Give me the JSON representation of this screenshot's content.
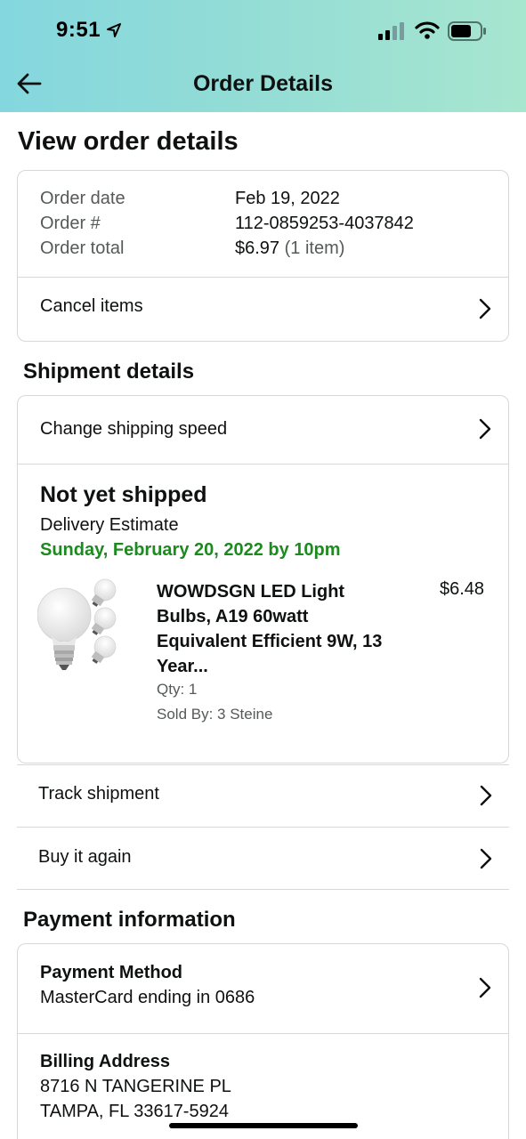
{
  "status_bar": {
    "time": "9:51",
    "icons": [
      "location-arrow-icon",
      "signal-bars-icon",
      "wifi-icon",
      "battery-icon"
    ]
  },
  "header": {
    "title": "Order Details",
    "back_icon": "arrow-left-icon",
    "gradient_colors": [
      "#84d7df",
      "#a7e6cf"
    ]
  },
  "page_title": "View order details",
  "order_summary": {
    "order_date_label": "Order date",
    "order_date": "Feb 19, 2022",
    "order_number_label": "Order #",
    "order_number": "112-0859253-4037842",
    "order_total_label": "Order total",
    "order_total": "$6.97",
    "item_count": "(1 item)",
    "cancel_items_label": "Cancel items"
  },
  "shipment": {
    "section_title": "Shipment details",
    "change_speed_label": "Change shipping speed",
    "status": "Not yet shipped",
    "delivery_estimate_label": "Delivery Estimate",
    "delivery_date": "Sunday, February 20, 2022 by 10pm",
    "delivery_date_color": "#1c8a1f",
    "item": {
      "title": "WOWDSGN LED Light Bulbs, A19 60watt Equivalent Efficient 9W, 13 Year...",
      "price": "$6.48",
      "qty": "Qty: 1",
      "sold_by": "Sold By: 3 Steine"
    },
    "track_shipment_label": "Track shipment",
    "buy_again_label": "Buy it again"
  },
  "payment": {
    "section_title": "Payment information",
    "method_heading": "Payment Method",
    "method_value": "MasterCard ending in 0686",
    "billing_heading": "Billing Address",
    "billing_line1": "8716 N TANGERINE PL",
    "billing_line2": "TAMPA, FL 33617-5924"
  }
}
